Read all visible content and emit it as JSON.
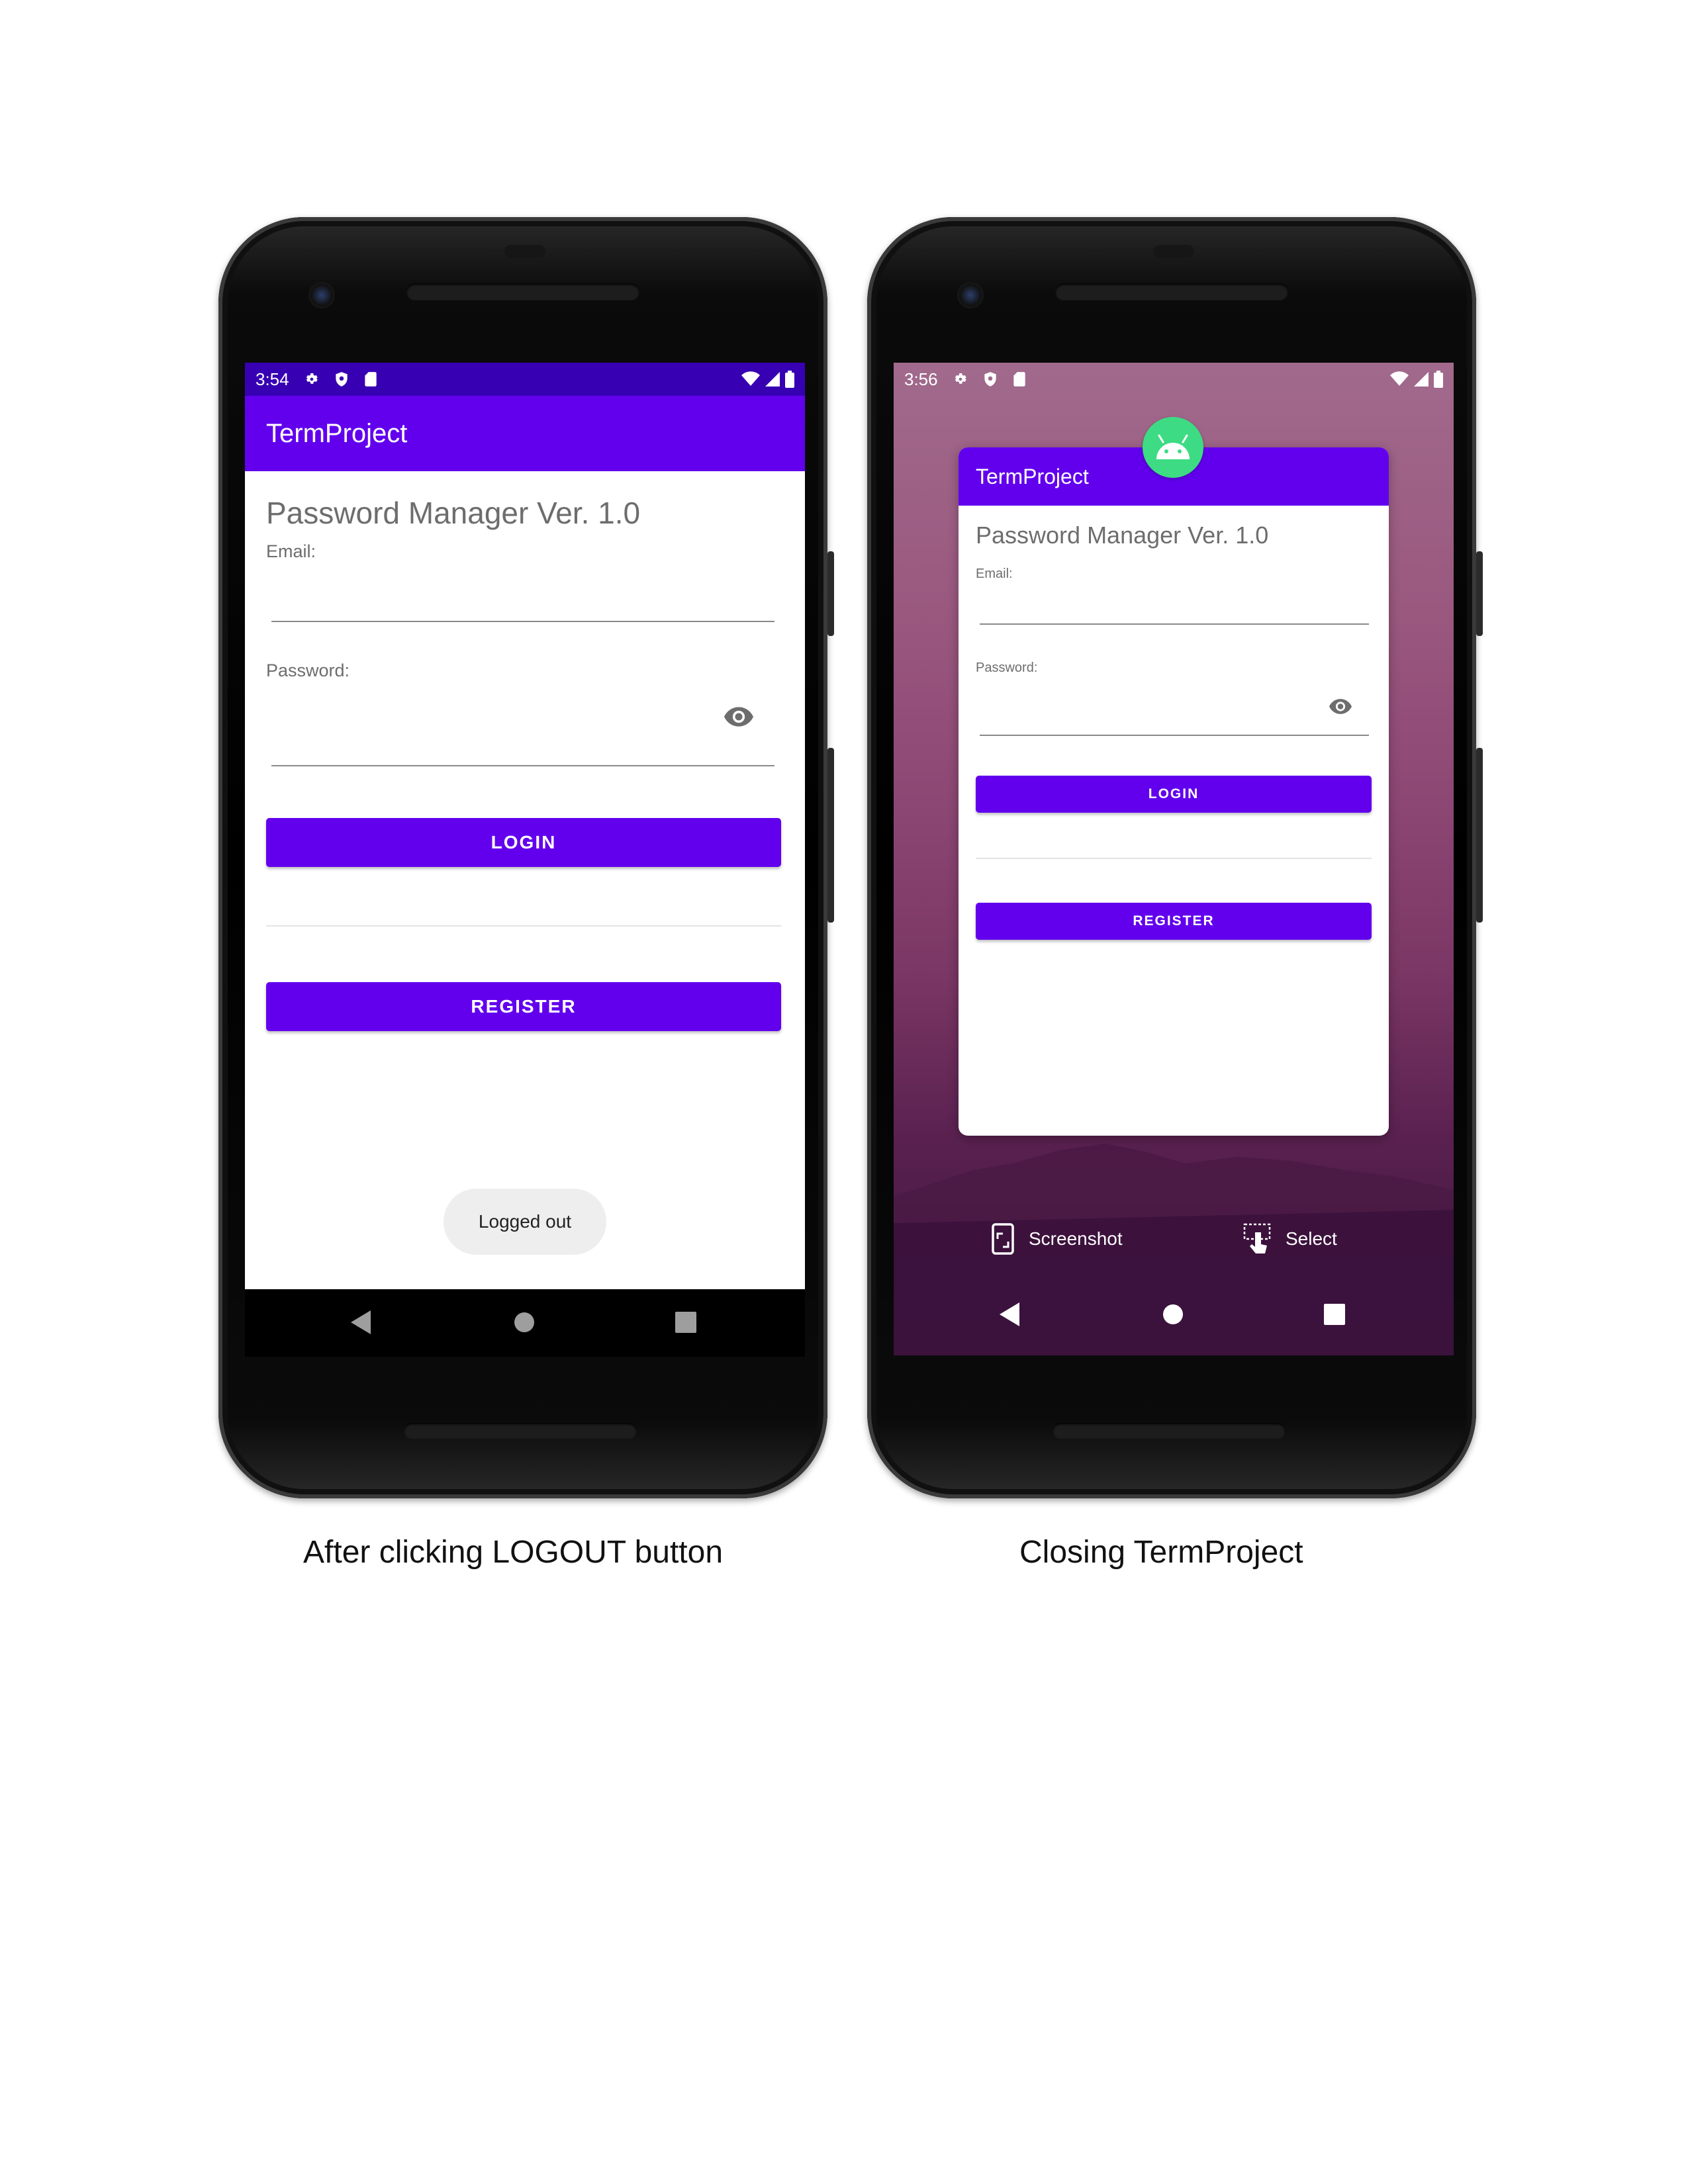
{
  "left_phone": {
    "status": {
      "time": "3:54"
    },
    "app": {
      "title": "TermProject",
      "heading": "Password Manager Ver. 1.0",
      "email_label": "Email:",
      "password_label": "Password:",
      "login_label": "LOGIN",
      "register_label": "REGISTER",
      "toast": "Logged out"
    },
    "caption": "After clicking LOGOUT button"
  },
  "right_phone": {
    "status": {
      "time": "3:56"
    },
    "card": {
      "title": "TermProject",
      "heading": "Password Manager Ver. 1.0",
      "email_label": "Email:",
      "password_label": "Password:",
      "login_label": "LOGIN",
      "register_label": "REGISTER"
    },
    "actions": {
      "screenshot": "Screenshot",
      "select": "Select"
    },
    "caption": "Closing TermProject"
  },
  "colors": {
    "primary": "#6200ee",
    "primary_dark": "#3700b3",
    "android_green": "#3ddc84"
  },
  "icons": [
    "settings-icon",
    "shield-icon",
    "sd-card-icon",
    "wifi-icon",
    "signal-icon",
    "battery-icon",
    "eye-icon",
    "back-icon",
    "home-icon",
    "recents-icon",
    "android-icon",
    "screenshot-icon",
    "select-icon"
  ]
}
